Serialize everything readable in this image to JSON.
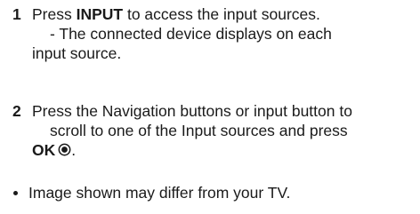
{
  "steps": [
    {
      "number": "1",
      "prefix": "Press ",
      "bold": "INPUT",
      "suffix": " to access the input sources.",
      "sub_line1": "- The connected device displays on each",
      "sub_line2": "input source."
    },
    {
      "number": "2",
      "line1": "Press the Navigation buttons or input button to",
      "line2": "scroll to one of the Input sources and press",
      "bold_end": "OK",
      "end_punct": ".",
      "icon": "ok-button-icon"
    }
  ],
  "note": {
    "text": "Image shown may differ from your TV."
  }
}
